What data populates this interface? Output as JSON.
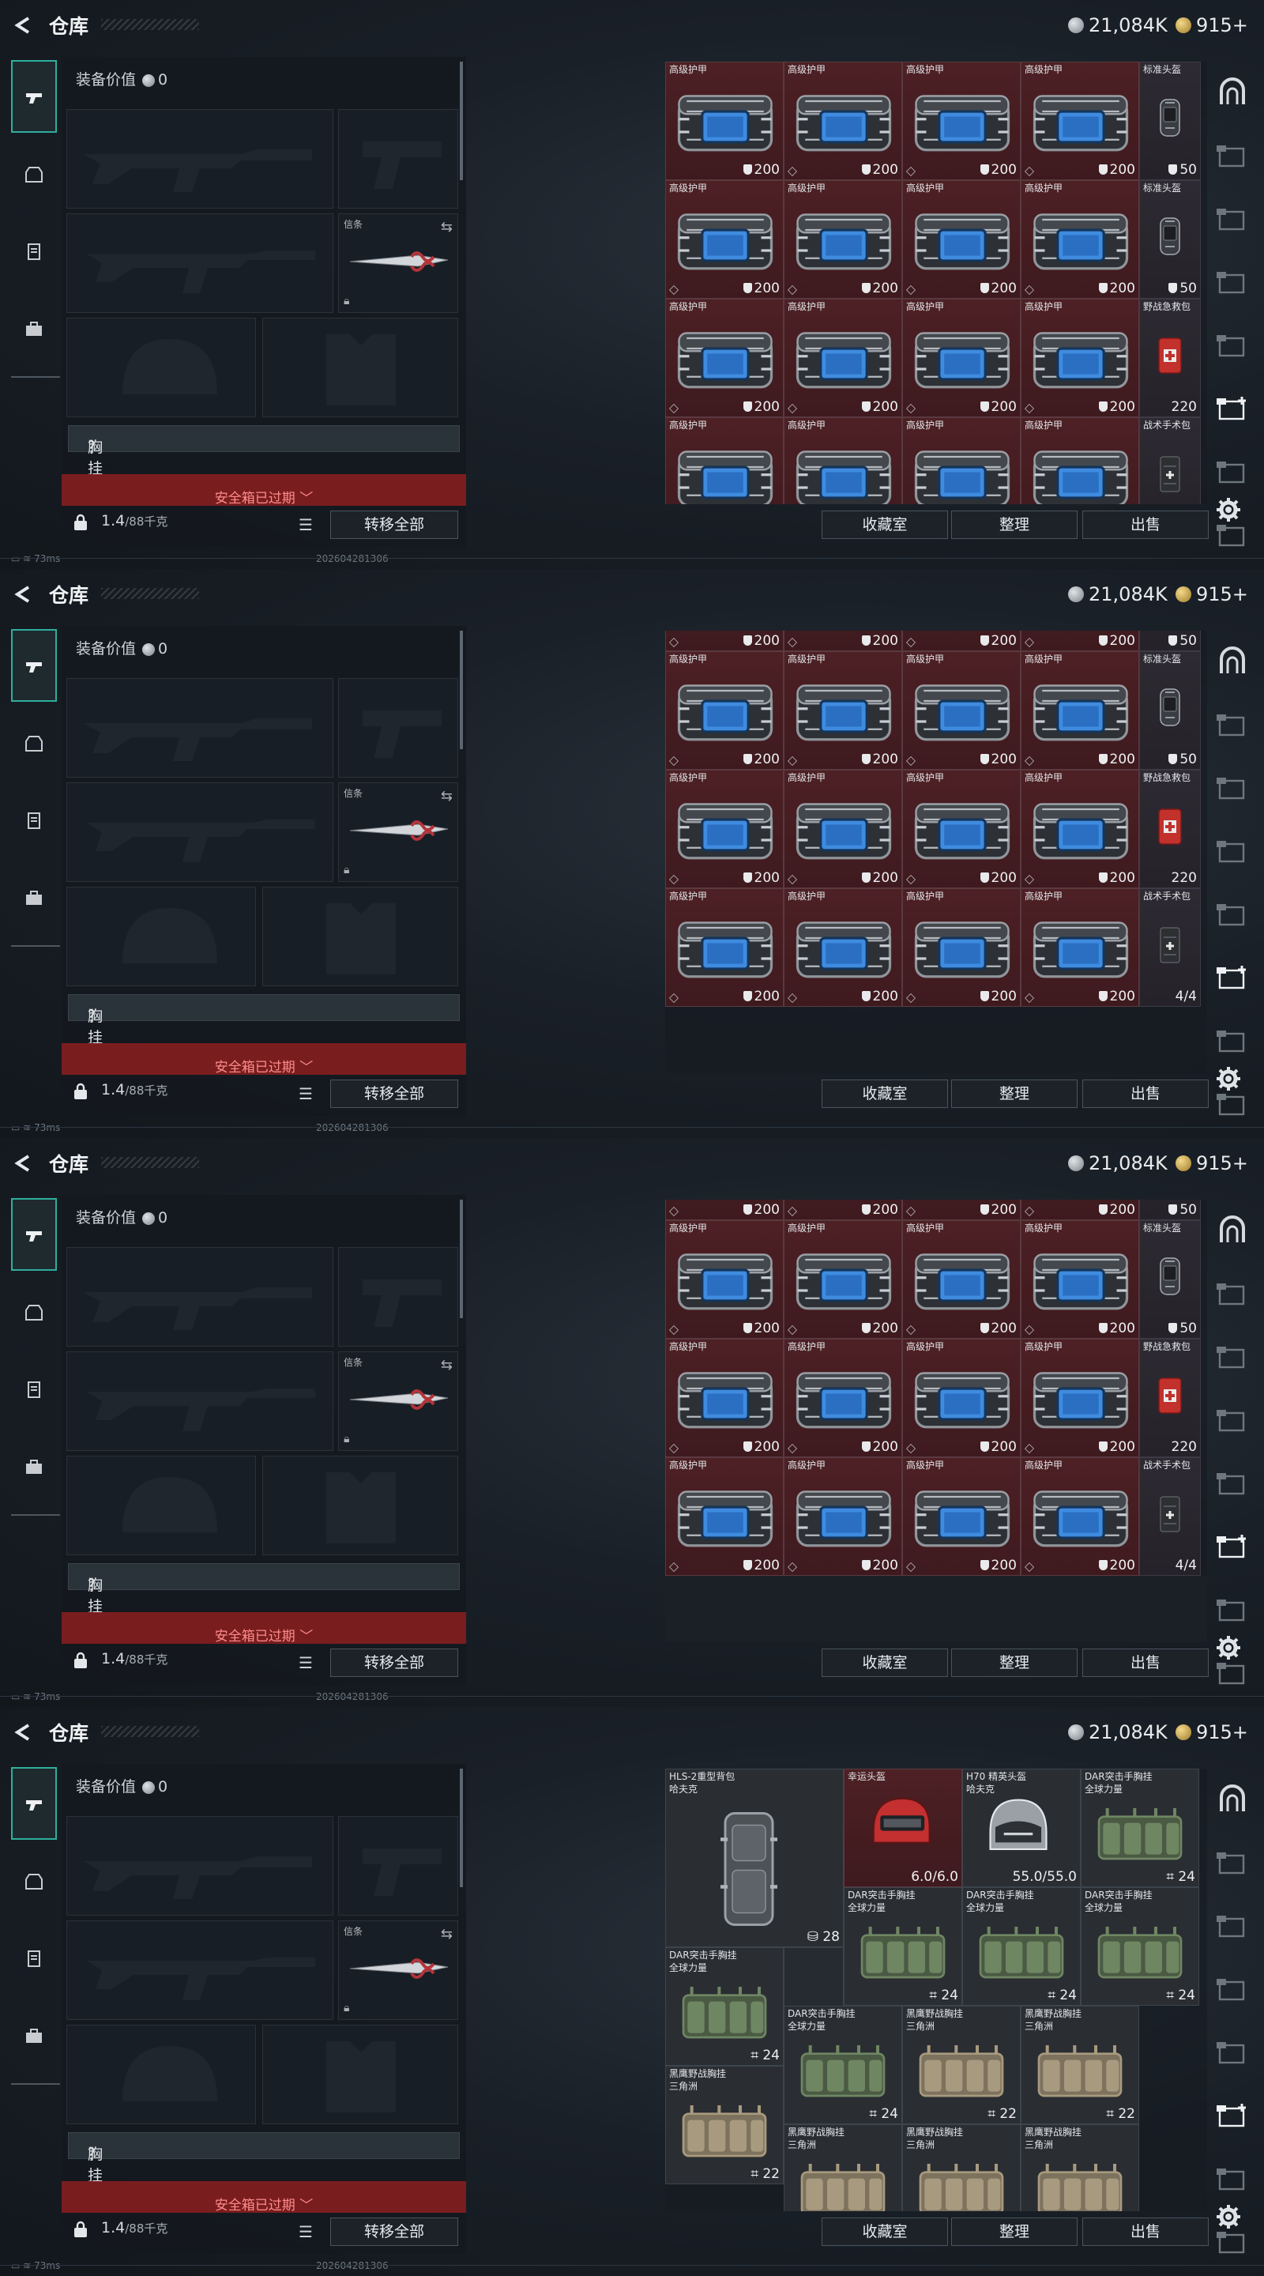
{
  "header": {
    "title": "仓库",
    "silver": "21,084K",
    "gold": "915+"
  },
  "loadout": {
    "equip_value_label": "装备价值",
    "equip_value": "0",
    "melee_label": "信条",
    "chest_label": "胸挂",
    "chest_value": "？",
    "safe_box_expired": "安全箱已过期",
    "weight": "1.4",
    "weight_max": "/88千克",
    "transfer_all": "转移全部"
  },
  "buttons": {
    "collection": "收藏室",
    "sort": "整理",
    "sell": "出售"
  },
  "status": {
    "ping": "73ms",
    "build": "202604281306"
  },
  "items": {
    "adv_armor": "高级护甲",
    "std_helmet": "标准头盔",
    "first_aid": "野战急救包",
    "surgery_kit": "战术手术包",
    "armor_val": "200",
    "helmet_val": "50",
    "aid_val": "220",
    "kit_val": "4/4",
    "backpack": "HLS-2重型背包",
    "backpack_sub": "哈夫克",
    "backpack_val": "28",
    "lucky_helmet": "幸运头盔",
    "lucky_helmet_val": "6.0/6.0",
    "h70_helmet": "H70 精英头盔",
    "h70_sub": "哈夫克",
    "h70_val": "55.0/55.0",
    "dar_rig": "DAR突击手胸挂",
    "dar_sub": "全球力量",
    "dar_val": "24",
    "blackhawk": "黑鹰野战胸挂",
    "blackhawk_sub": "三角洲",
    "blackhawk_val": "22"
  }
}
